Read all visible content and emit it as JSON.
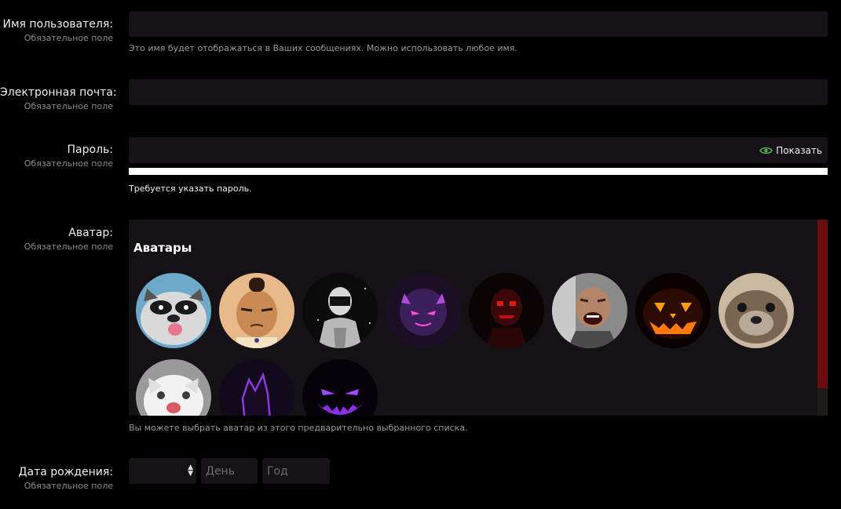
{
  "username": {
    "label": "Имя пользователя:",
    "required": "Обязательное поле",
    "value": "",
    "hint": "Это имя будет отображаться в Ваших сообщениях. Можно использовать любое имя."
  },
  "email": {
    "label": "Электронная почта:",
    "required": "Обязательное поле",
    "value": ""
  },
  "password": {
    "label": "Пароль:",
    "required": "Обязательное поле",
    "value": "",
    "show_label": "Показать",
    "show_icon": "eye-icon",
    "message": "Требуется указать пароль."
  },
  "avatar": {
    "label": "Аватар:",
    "required": "Обязательное поле",
    "panel_title": "Аватары",
    "hint": "Вы можете выбрать аватар из этого предварительно выбранного списка.",
    "items": [
      {
        "name": "raccoon-avatar"
      },
      {
        "name": "cartoon-boy-avatar"
      },
      {
        "name": "masked-man-avatar"
      },
      {
        "name": "purple-devil-avatar"
      },
      {
        "name": "red-mask-avatar"
      },
      {
        "name": "laughing-man-avatar"
      },
      {
        "name": "pumpkin-avatar"
      },
      {
        "name": "otter-avatar"
      },
      {
        "name": "white-cat-avatar"
      },
      {
        "name": "purple-wolf-avatar"
      },
      {
        "name": "purple-smile-avatar"
      }
    ]
  },
  "birthdate": {
    "label": "Дата рождения:",
    "required": "Обязательное поле",
    "month_value": "",
    "day_placeholder": "День",
    "year_placeholder": "Год"
  },
  "colors": {
    "background": "#000000",
    "field": "#151315",
    "scroll_thumb": "#6a0d0d",
    "eye_icon": "#4caf50"
  }
}
